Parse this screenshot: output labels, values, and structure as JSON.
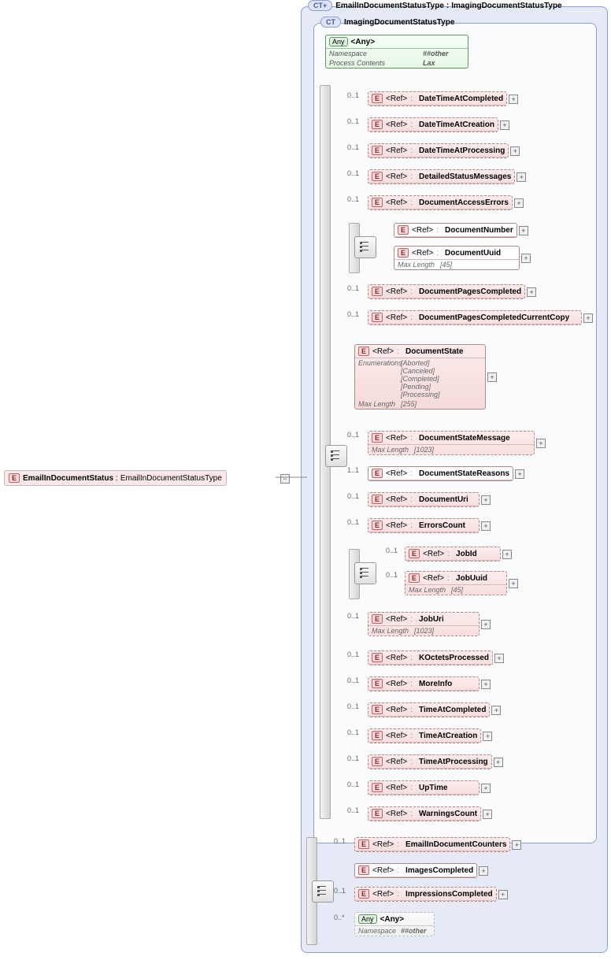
{
  "root": {
    "name": "EmailInDocumentStatus",
    "type": "EmailInDocumentStatusType"
  },
  "outerCT": {
    "name": "EmailInDocumentStatusType",
    "base": "ImagingDocumentStatusType"
  },
  "innerCT": {
    "name": "ImagingDocumentStatusType"
  },
  "badges": {
    "ct": "CT",
    "ctExt": "CT+",
    "any": "Any",
    "e": "E",
    "ref": "<Ref>"
  },
  "anyTop": {
    "title": "<Any>",
    "k1": "Namespace",
    "v1": "##other",
    "k2": "Process Contents",
    "v2": "Lax"
  },
  "occ": {
    "o01": "0..1",
    "o11": "1..1",
    "oMany": "0..*"
  },
  "maxLen": {
    "label": "Max Length",
    "v45": "[45]",
    "v255": "[255]",
    "v1023": "[1023]"
  },
  "enumLabel": "Enumerations",
  "docState": {
    "name": "DocumentState",
    "enums": [
      "[Aborted]",
      "[Canceled]",
      "[Completed]",
      "[Pending]",
      "[Processing]"
    ]
  },
  "items": {
    "dtCompleted": "DateTimeAtCompleted",
    "dtCreation": "DateTimeAtCreation",
    "dtProcessing": "DateTimeAtProcessing",
    "detailedMsgs": "DetailedStatusMessages",
    "accessErrors": "DocumentAccessErrors",
    "docNumber": "DocumentNumber",
    "docUuid": "DocumentUuid",
    "pagesCompleted": "DocumentPagesCompleted",
    "pagesCompletedCopy": "DocumentPagesCompletedCurrentCopy",
    "stateMsg": "DocumentStateMessage",
    "stateReasons": "DocumentStateReasons",
    "docUri": "DocumentUri",
    "errorsCount": "ErrorsCount",
    "jobId": "JobId",
    "jobUuid": "JobUuid",
    "jobUri": "JobUri",
    "kOctets": "KOctetsProcessed",
    "moreInfo": "MoreInfo",
    "timeCompleted": "TimeAtCompleted",
    "timeCreation": "TimeAtCreation",
    "timeProcessing": "TimeAtProcessing",
    "upTime": "UpTime",
    "warnCount": "WarningsCount",
    "emailCounters": "EmailInDocumentCounters",
    "imagesCompleted": "ImagesCompleted",
    "impressions": "ImpressionsCompleted"
  },
  "anyBottom": {
    "title": "<Any>",
    "k1": "Namespace",
    "v1": "##other"
  },
  "chart_data": {
    "type": "xsd-schema-tree",
    "root_element": "EmailInDocumentStatus",
    "root_type": "EmailInDocumentStatusType",
    "base_type": "ImagingDocumentStatusType",
    "wildcard": {
      "namespace": "##other",
      "processContents": "Lax"
    },
    "inherited_sequence": [
      {
        "ref": "DateTimeAtCompleted",
        "occurs": "0..1"
      },
      {
        "ref": "DateTimeAtCreation",
        "occurs": "0..1"
      },
      {
        "ref": "DateTimeAtProcessing",
        "occurs": "0..1"
      },
      {
        "ref": "DetailedStatusMessages",
        "occurs": "0..1"
      },
      {
        "ref": "DocumentAccessErrors",
        "occurs": "0..1"
      },
      {
        "choice": [
          {
            "ref": "DocumentNumber"
          },
          {
            "ref": "DocumentUuid",
            "maxLength": 45
          }
        ],
        "occurs": "0..1"
      },
      {
        "ref": "DocumentPagesCompleted",
        "occurs": "0..1"
      },
      {
        "ref": "DocumentPagesCompletedCurrentCopy",
        "occurs": "0..1"
      },
      {
        "ref": "DocumentState",
        "occurs": "1..1",
        "enum": [
          "Aborted",
          "Canceled",
          "Completed",
          "Pending",
          "Processing"
        ],
        "maxLength": 255
      },
      {
        "ref": "DocumentStateMessage",
        "occurs": "0..1",
        "maxLength": 1023
      },
      {
        "ref": "DocumentStateReasons",
        "occurs": "1..1"
      },
      {
        "ref": "DocumentUri",
        "occurs": "0..1"
      },
      {
        "ref": "ErrorsCount",
        "occurs": "0..1"
      },
      {
        "choice": [
          {
            "ref": "JobId"
          },
          {
            "ref": "JobUuid",
            "maxLength": 45
          }
        ],
        "occurs": "0..1"
      },
      {
        "ref": "JobUri",
        "occurs": "0..1",
        "maxLength": 1023
      },
      {
        "ref": "KOctetsProcessed",
        "occurs": "0..1"
      },
      {
        "ref": "MoreInfo",
        "occurs": "0..1"
      },
      {
        "ref": "TimeAtCompleted",
        "occurs": "0..1"
      },
      {
        "ref": "TimeAtCreation",
        "occurs": "0..1"
      },
      {
        "ref": "TimeAtProcessing",
        "occurs": "0..1"
      },
      {
        "ref": "UpTime",
        "occurs": "0..1"
      },
      {
        "ref": "WarningsCount",
        "occurs": "0..1"
      }
    ],
    "extension_sequence": [
      {
        "ref": "EmailInDocumentCounters",
        "occurs": "0..1"
      },
      {
        "ref": "ImagesCompleted",
        "occurs": "1..1"
      },
      {
        "ref": "ImpressionsCompleted",
        "occurs": "0..1"
      },
      {
        "any": true,
        "namespace": "##other",
        "occurs": "0..*"
      }
    ]
  }
}
